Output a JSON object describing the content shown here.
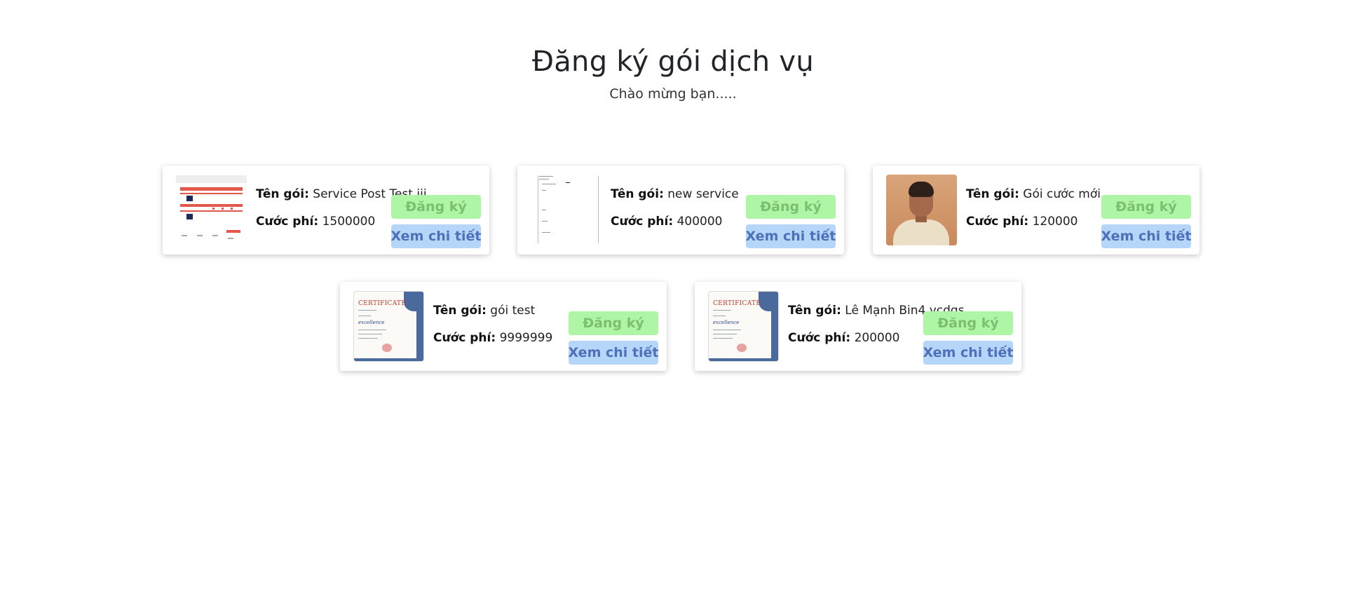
{
  "header": {
    "title": "Đăng ký gói dịch vụ",
    "subtitle": "Chào mừng bạn....."
  },
  "labels": {
    "name": "Tên gói:",
    "price": "Cước phí:",
    "register": "Đăng ký",
    "detail": "Xem chi tiết"
  },
  "colors": {
    "register_bg": "#aef5a6",
    "register_text": "#7cc06f",
    "detail_bg": "#b5d6f8",
    "detail_text": "#4e70b8"
  },
  "packages": [
    {
      "name": "Service Post Test iii",
      "price": "1500000",
      "thumbnail": "app-screenshot-image"
    },
    {
      "name": "new service",
      "price": "400000",
      "thumbnail": "sketch-image"
    },
    {
      "name": "Gói cước mới",
      "price": "120000",
      "thumbnail": "portrait-photo"
    },
    {
      "name": "gói test",
      "price": "9999999",
      "thumbnail": "certificate-image"
    },
    {
      "name": "Lê Mạnh Bin4 vcdgs",
      "price": "200000",
      "thumbnail": "certificate-image"
    }
  ]
}
